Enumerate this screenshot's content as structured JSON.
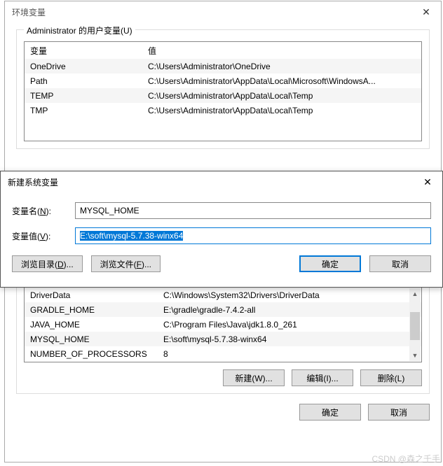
{
  "env_window": {
    "title": "环境变量",
    "user_group_label": "Administrator 的用户变量(U)",
    "columns": {
      "var": "变量",
      "val": "值"
    },
    "user_vars": [
      {
        "name": "OneDrive",
        "value": "C:\\Users\\Administrator\\OneDrive"
      },
      {
        "name": "Path",
        "value": "C:\\Users\\Administrator\\AppData\\Local\\Microsoft\\WindowsA..."
      },
      {
        "name": "TEMP",
        "value": "C:\\Users\\Administrator\\AppData\\Local\\Temp"
      },
      {
        "name": "TMP",
        "value": "C:\\Users\\Administrator\\AppData\\Local\\Temp"
      }
    ],
    "sys_vars": [
      {
        "name": "DriverData",
        "value": "C:\\Windows\\System32\\Drivers\\DriverData"
      },
      {
        "name": "GRADLE_HOME",
        "value": "E:\\gradle\\gradle-7.4.2-all"
      },
      {
        "name": "JAVA_HOME",
        "value": "C:\\Program Files\\Java\\jdk1.8.0_261"
      },
      {
        "name": "MYSQL_HOME",
        "value": "E:\\soft\\mysql-5.7.38-winx64"
      },
      {
        "name": "NUMBER_OF_PROCESSORS",
        "value": "8"
      }
    ],
    "buttons": {
      "new": "新建(W)...",
      "edit": "编辑(I)...",
      "delete": "删除(L)",
      "ok": "确定",
      "cancel": "取消"
    }
  },
  "new_var_dialog": {
    "title": "新建系统变量",
    "name_label": "变量名(N):",
    "value_label": "变量值(V):",
    "name_value": "MYSQL_HOME",
    "value_value": "E:\\soft\\mysql-5.7.38-winx64",
    "browse_dir": "浏览目录(D)...",
    "browse_file": "浏览文件(F)...",
    "ok": "确定",
    "cancel": "取消"
  },
  "watermark": "CSDN @森之千手"
}
